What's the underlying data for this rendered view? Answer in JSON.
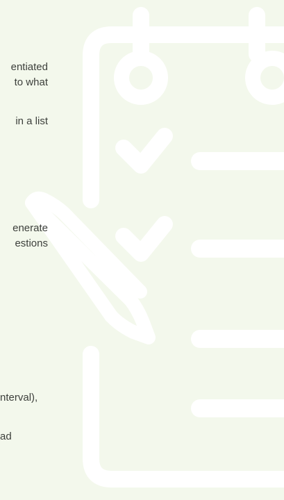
{
  "theme": {
    "background": "#f3f8ec",
    "illustration_color": "#ffffff",
    "text_color": "#3c3f3b"
  },
  "illustration": {
    "name": "checklist-clipboard-with-pencil",
    "icons": [
      "clipboard-icon",
      "checkmark-icon",
      "pencil-icon"
    ]
  },
  "text_fragments": [
    {
      "id": "line-1",
      "text": "entiated"
    },
    {
      "id": "line-2",
      "text": "to  what"
    },
    {
      "id": "line-3",
      "text": "in a list"
    },
    {
      "id": "line-4",
      "text": "enerate"
    },
    {
      "id": "line-5",
      "text": "estions"
    },
    {
      "id": "line-6",
      "text": "nterval),"
    },
    {
      "id": "line-7",
      "text": "ad"
    }
  ]
}
